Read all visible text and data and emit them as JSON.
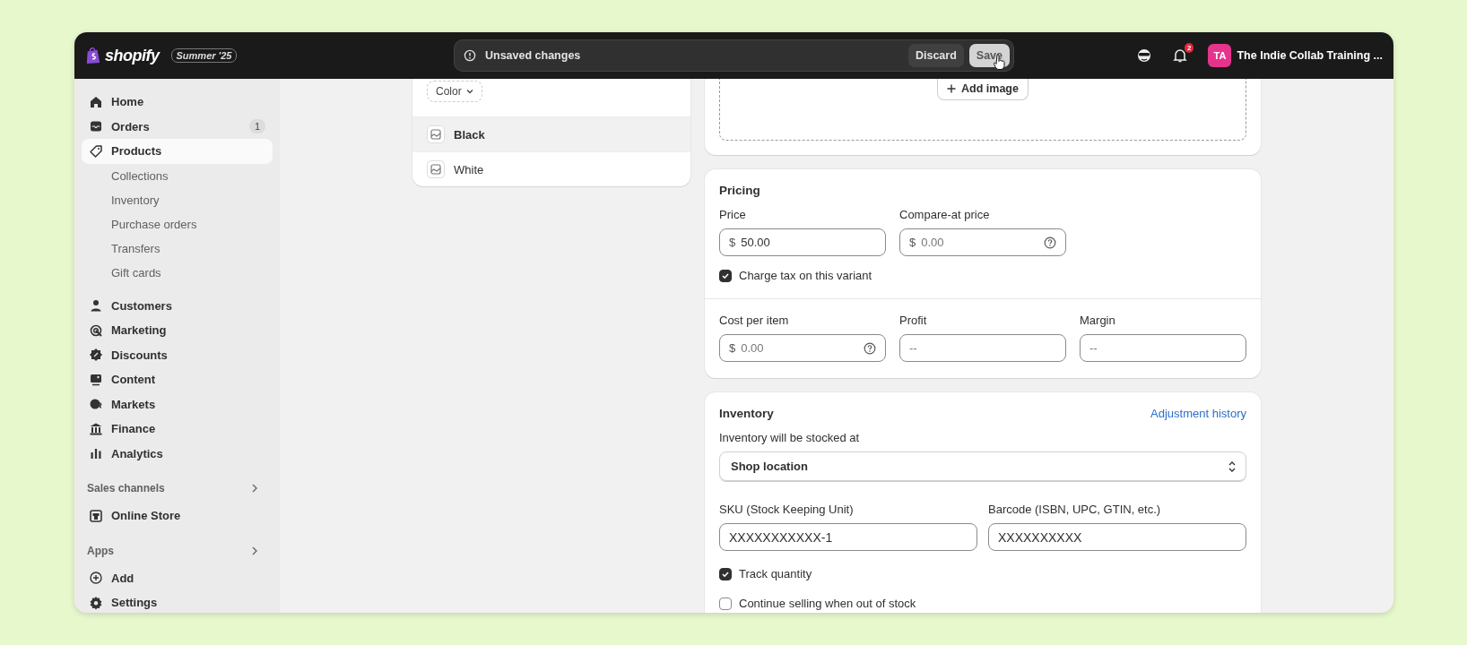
{
  "topbar": {
    "logo": "shopify",
    "edition": "Summer '25",
    "unsaved": {
      "message": "Unsaved changes",
      "buttons": [
        {
          "label": "Discard",
          "kind": "secondary"
        },
        {
          "label": "Save",
          "kind": "primary"
        }
      ]
    },
    "notification_count": "2",
    "store": {
      "initials": "TA",
      "name": "The Indie Collab Training ..."
    }
  },
  "sidebar": {
    "items": [
      {
        "label": "Home",
        "selected": false
      },
      {
        "label": "Orders",
        "selected": false,
        "badge": "1"
      },
      {
        "label": "Products",
        "selected": true,
        "children": [
          {
            "label": "Collections"
          },
          {
            "label": "Inventory"
          },
          {
            "label": "Purchase orders"
          },
          {
            "label": "Transfers"
          },
          {
            "label": "Gift cards"
          }
        ]
      },
      {
        "label": "Customers",
        "selected": false
      },
      {
        "label": "Marketing",
        "selected": false
      },
      {
        "label": "Discounts",
        "selected": false
      },
      {
        "label": "Content",
        "selected": false
      },
      {
        "label": "Markets",
        "selected": false
      },
      {
        "label": "Finance",
        "selected": false
      },
      {
        "label": "Analytics",
        "selected": false
      }
    ],
    "sections": [
      {
        "title": "Sales channels",
        "items": [
          {
            "label": "Online Store",
            "selected": false
          }
        ]
      },
      {
        "title": "Apps",
        "items": [
          {
            "label": "Add",
            "selected": false
          }
        ]
      }
    ],
    "footer_item": {
      "label": "Settings",
      "selected": false
    }
  },
  "variants": {
    "option_chip": "Color",
    "items": [
      {
        "label": "Black",
        "selected": true
      },
      {
        "label": "White",
        "selected": false
      }
    ]
  },
  "media": {
    "add_button": "Add image"
  },
  "pricing": {
    "title": "Pricing",
    "fields": [
      {
        "label": "Price",
        "prefix": "$",
        "value": "50.00",
        "help": false
      },
      {
        "label": "Compare-at price",
        "prefix": "$",
        "placeholder": "0.00",
        "help": true
      }
    ],
    "checkbox": {
      "label": "Charge tax on this variant",
      "checked": true
    },
    "cost_fields": [
      {
        "label": "Cost per item",
        "prefix": "$",
        "placeholder": "0.00",
        "help": true
      },
      {
        "label": "Profit",
        "placeholder": "--",
        "help": false
      },
      {
        "label": "Margin",
        "placeholder": "--",
        "help": false
      }
    ]
  },
  "inventory": {
    "title": "Inventory",
    "link": "Adjustment history",
    "location_label": "Inventory will be stocked at",
    "location": "Shop location",
    "fields": [
      {
        "label": "SKU (Stock Keeping Unit)",
        "value": "XXXXXXXXXXX-1"
      },
      {
        "label": "Barcode (ISBN, UPC, GTIN, etc.)",
        "value": "XXXXXXXXXX"
      }
    ],
    "checkboxes": [
      {
        "label": "Track quantity",
        "checked": true
      },
      {
        "label": "Continue selling when out of stock",
        "checked": false
      }
    ]
  }
}
